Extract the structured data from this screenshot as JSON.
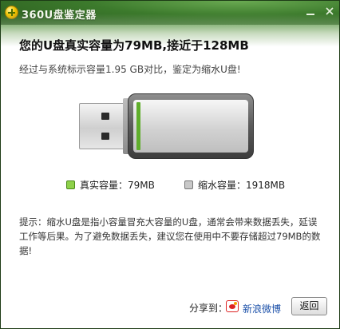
{
  "window": {
    "title": "360U盘鉴定器"
  },
  "result": {
    "headline": "您的U盘真实容量为79MB,接近于128MB",
    "subline": "经过与系统标示容量1.95 GB对比，鉴定为缩水U盘!"
  },
  "usb_visual": {
    "real_fraction": 0.04
  },
  "legend": {
    "real_label": "真实容量：79MB",
    "shrink_label": "缩水容量：1918MB",
    "real_color": "#8ed14a",
    "shrink_color": "#c8c8c8"
  },
  "tip": {
    "text": "提示：缩水U盘是指小容量冒充大容量的U盘，通常会带来数据丢失，延误工作等后果。为了避免数据丢失，建议您在使用中不要存储超过79MB的数据!"
  },
  "footer": {
    "share_label": "分享到：",
    "weibo_label": "新浪微博",
    "back_label": "返回"
  },
  "icons": {
    "minimize": "minimize-icon",
    "close": "close-icon",
    "logo": "360-logo-icon",
    "weibo": "weibo-icon"
  }
}
